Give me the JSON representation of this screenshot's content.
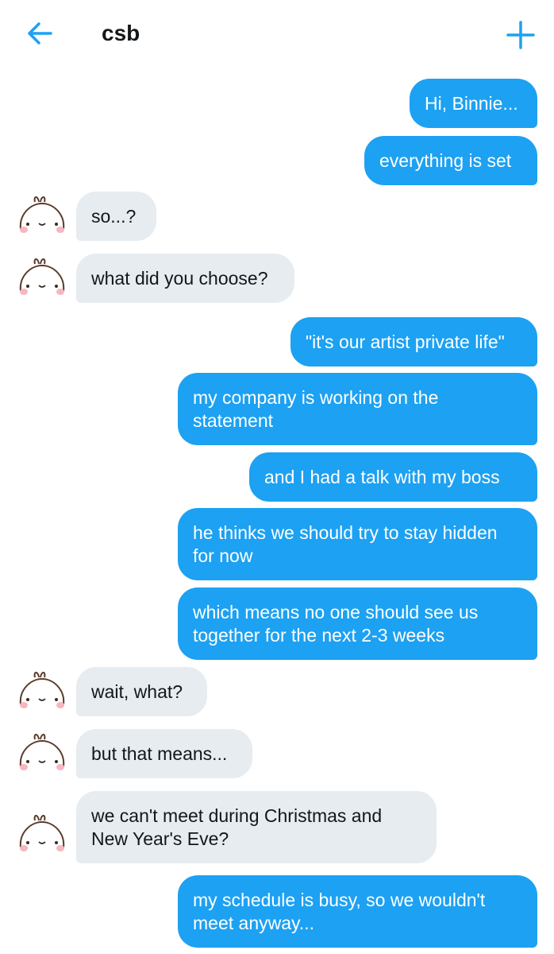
{
  "header": {
    "title": "csb",
    "back_icon": "arrow-left-icon",
    "compose_icon": "plus-icon",
    "accent": "#1da1f2"
  },
  "messages": [
    {
      "text": "Hi, Binnie...",
      "dir": "out"
    },
    {
      "text": "everything is set",
      "dir": "out"
    },
    {
      "text": "so...?",
      "dir": "in"
    },
    {
      "text": "what did you choose?",
      "dir": "in"
    },
    {
      "text": "\"it's our artist private life\"",
      "dir": "out"
    },
    {
      "lines": [
        "my company is working on the",
        "statement"
      ],
      "dir": "out"
    },
    {
      "text": "and I had a talk with my boss",
      "dir": "out"
    },
    {
      "lines": [
        "he thinks we should try to stay hidden",
        "for now"
      ],
      "dir": "out"
    },
    {
      "lines": [
        "which means no one should see us",
        "together for the next 2-3 weeks"
      ],
      "dir": "out"
    },
    {
      "text": "wait, what?",
      "dir": "in"
    },
    {
      "text": "but that means...",
      "dir": "in"
    },
    {
      "lines": [
        "we can't meet during Christmas and",
        "New Year's Eve?"
      ],
      "dir": "in"
    },
    {
      "lines": [
        "my schedule is busy, so we wouldn't",
        "meet anyway..."
      ],
      "dir": "out"
    }
  ]
}
